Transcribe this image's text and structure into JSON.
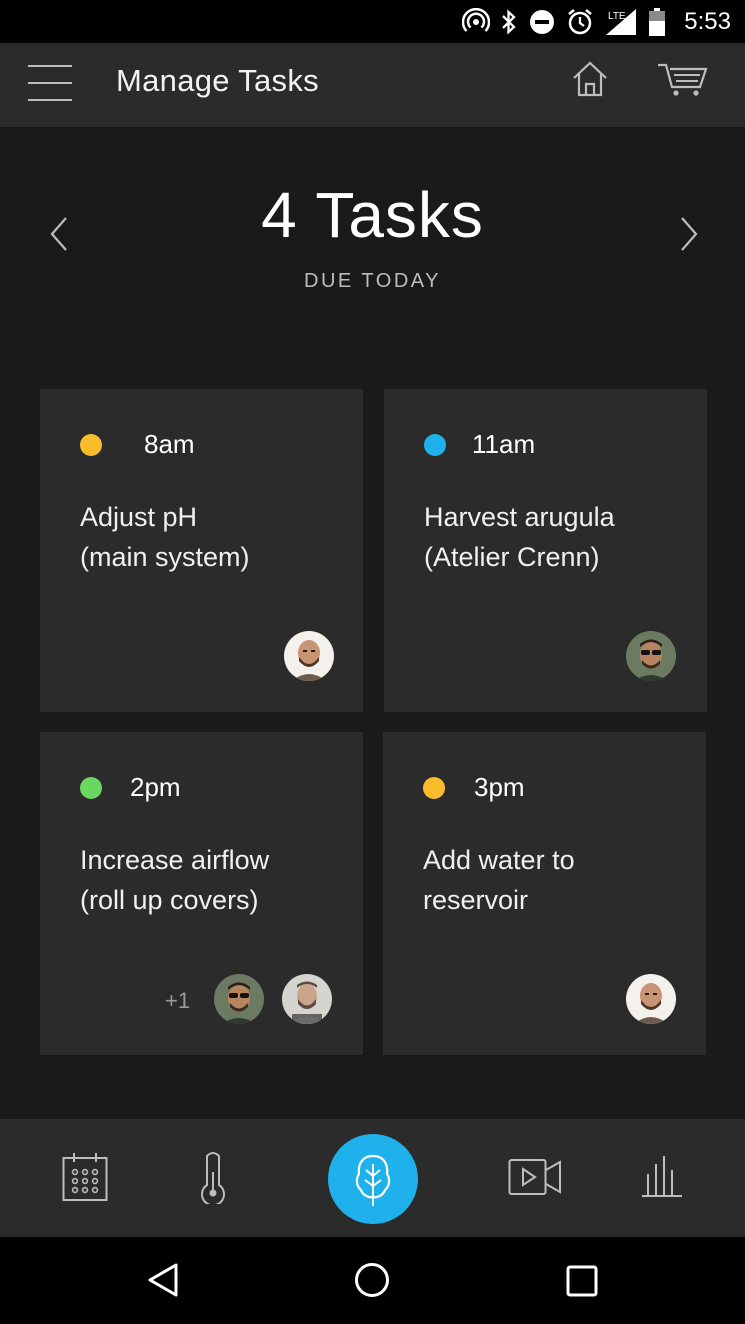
{
  "status_bar": {
    "time": "5:53",
    "icons": [
      "hotspot-icon",
      "bluetooth-icon",
      "do-not-disturb-icon",
      "alarm-icon",
      "lte-signal-icon",
      "battery-icon"
    ],
    "network_label": "LTE"
  },
  "app_bar": {
    "title": "Manage Tasks",
    "icons": [
      "menu-icon",
      "home-icon",
      "cart-icon"
    ]
  },
  "summary": {
    "title": "4 Tasks",
    "subtitle": "DUE TODAY"
  },
  "tasks": [
    {
      "time": "8am",
      "line1": "Adjust pH",
      "line2": "(main system)",
      "dot_color": "#fbbc2c",
      "assignees": [
        "avatar-bald-man"
      ],
      "extra_count": ""
    },
    {
      "time": "11am",
      "line1": "Harvest arugula",
      "line2": "(Atelier Crenn)",
      "dot_color": "#1eb1ec",
      "assignees": [
        "avatar-sunglasses-man"
      ],
      "extra_count": ""
    },
    {
      "time": "2pm",
      "line1": "Increase airflow",
      "line2": "(roll up covers)",
      "dot_color": "#6bd660",
      "assignees": [
        "avatar-sunglasses-man",
        "avatar-bearded-man"
      ],
      "extra_count": "+1"
    },
    {
      "time": "3pm",
      "line1": "Add water to",
      "line2": "reservoir",
      "dot_color": "#fbbc2c",
      "assignees": [
        "avatar-bald-man"
      ],
      "extra_count": ""
    }
  ],
  "bottom_nav": {
    "items": [
      "calendar-icon",
      "thermometer-icon",
      "leaf-icon",
      "video-icon",
      "bar-chart-icon"
    ],
    "accent_color": "#1eb1ec"
  },
  "system_nav": {
    "items": [
      "back-icon",
      "home-circle-icon",
      "recents-icon"
    ]
  }
}
